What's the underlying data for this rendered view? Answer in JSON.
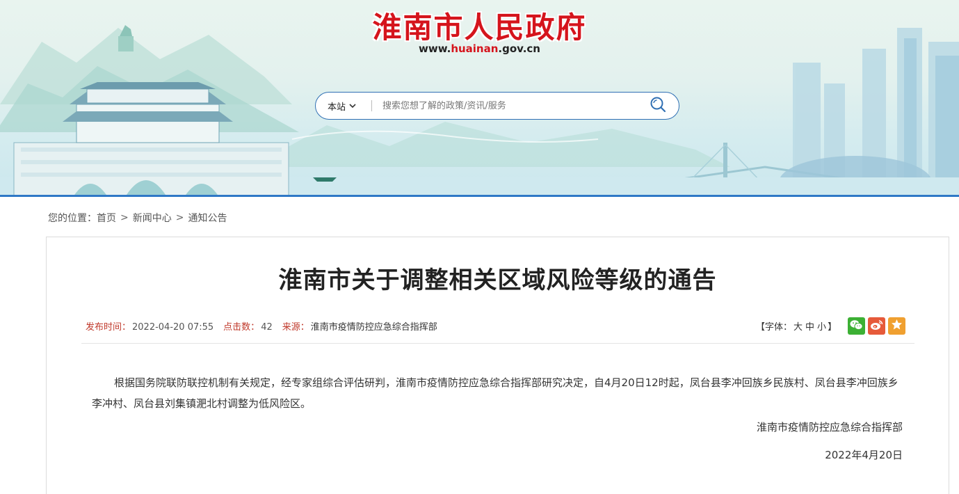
{
  "header": {
    "site_title": "淮南市人民政府",
    "url_prefix": "www.",
    "url_highlight": "huainan",
    "url_suffix": ".gov.cn",
    "search": {
      "scope": "本站",
      "placeholder": "搜索您想了解的政策/资讯/服务"
    }
  },
  "breadcrumb": {
    "label": "您的位置：",
    "items": [
      "首页",
      "新闻中心",
      "通知公告"
    ],
    "separator": ">"
  },
  "article": {
    "title": "淮南市关于调整相关区域风险等级的通告",
    "meta": {
      "publish_label": "发布时间：",
      "publish_value": "2022-04-20 07:55",
      "clicks_label": "点击数：",
      "clicks_value": "42",
      "source_label": "来源：",
      "source_value": "淮南市疫情防控应急综合指挥部"
    },
    "font_size": {
      "open": "【字体：",
      "large": "大",
      "medium": "中",
      "small": "小",
      "close": "】"
    },
    "share_icons": [
      "wechat-icon",
      "weibo-icon",
      "favorite-icon"
    ],
    "body": "根据国务院联防联控机制有关规定，经专家组综合评估研判，淮南市疫情防控应急综合指挥部研究决定，自4月20日12时起，凤台县李冲回族乡民族村、凤台县李冲回族乡李冲村、凤台县刘集镇淝北村调整为低风险区。",
    "signature": "淮南市疫情防控应急综合指挥部",
    "date": "2022年4月20日"
  },
  "colors": {
    "title_red": "#d5141c",
    "accent_blue": "#2f78c6",
    "wechat": "#3cb034",
    "weibo": "#e65a3a",
    "favorite": "#f0a030"
  }
}
